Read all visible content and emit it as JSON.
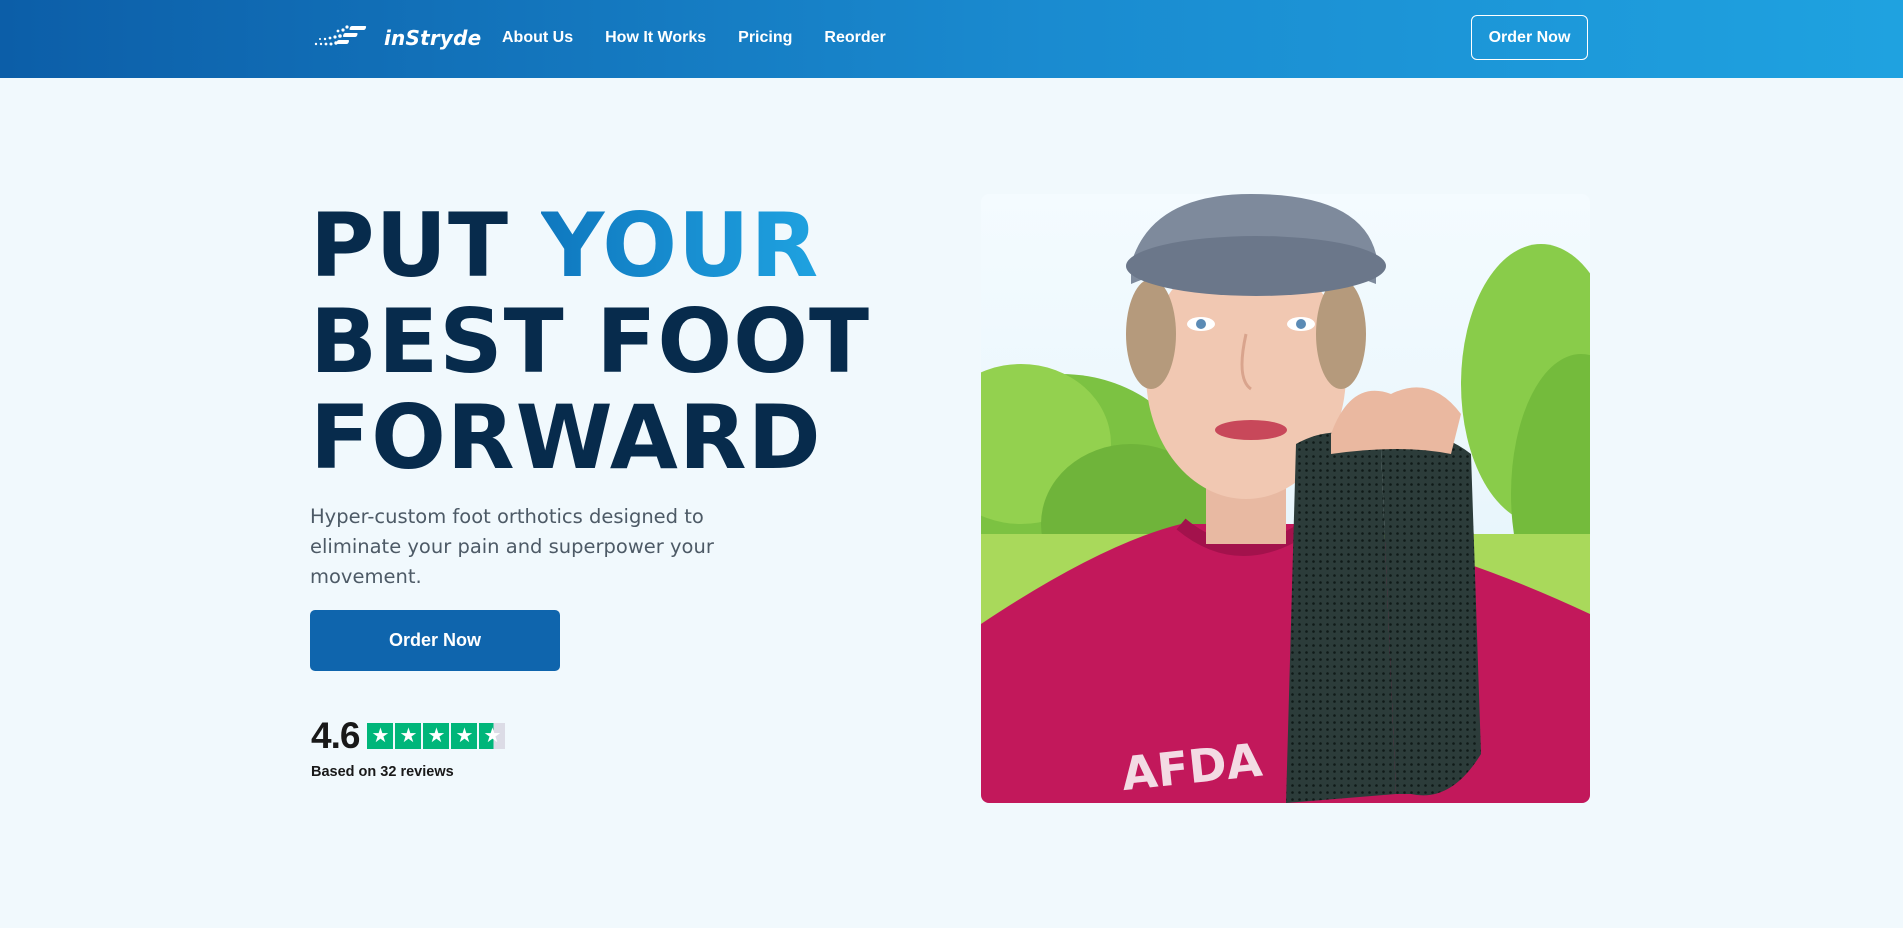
{
  "nav": {
    "brand": "inStryde",
    "links": [
      "About Us",
      "How It Works",
      "Pricing",
      "Reorder"
    ],
    "cta": "Order Now"
  },
  "hero": {
    "title_line1_a": "PUT ",
    "title_line1_b": "YOUR",
    "title_line2": "BEST FOOT",
    "title_line3": "FORWARD",
    "subtitle": "Hyper-custom foot orthotics designed to eliminate your pain and superpower your movement.",
    "cta": "Order Now",
    "rating": {
      "score": "4.6",
      "stars": 4.5,
      "reviews": "Based on 32 reviews"
    }
  },
  "colors": {
    "navbar_start": "#0c5ea8",
    "navbar_end": "#1fa2e0",
    "page_bg": "#f1f9fd",
    "headline": "#072b4c",
    "accent": "#1a8bd0",
    "cta_bg": "#0f65ad",
    "star_green": "#00b67a"
  },
  "icons": {
    "logo": "dotted-stripes-logo-icon",
    "star": "star-icon"
  }
}
